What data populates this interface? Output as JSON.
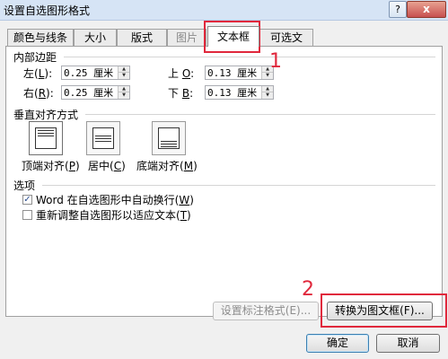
{
  "window": {
    "title": "设置自选图形格式",
    "help_label": "?",
    "close_label": "x"
  },
  "tabs": [
    {
      "label": "颜色与线条",
      "state": "normal"
    },
    {
      "label": "大小",
      "state": "normal"
    },
    {
      "label": "版式",
      "state": "normal"
    },
    {
      "label": "图片",
      "state": "disabled"
    },
    {
      "label": "文本框",
      "state": "active"
    },
    {
      "label": "可选文字",
      "state": "normal"
    }
  ],
  "internal_margin": {
    "title": "内部边距",
    "left": {
      "label": "左",
      "key": "L",
      "value": "0.25 厘米"
    },
    "right": {
      "label": "右",
      "key": "R",
      "value": "0.25 厘米"
    },
    "top": {
      "label": "上",
      "key": "O",
      "value": "0.13 厘米"
    },
    "bottom": {
      "label": "下",
      "key": "B",
      "value": "0.13 厘米"
    }
  },
  "vertical_align": {
    "title": "垂直对齐方式",
    "options": [
      {
        "label": "顶端对齐",
        "key": "P",
        "selected": true
      },
      {
        "label": "居中",
        "key": "C",
        "selected": false
      },
      {
        "label": "底端对齐",
        "key": "M",
        "selected": false
      }
    ]
  },
  "options": {
    "title": "选项",
    "word_wrap": {
      "label": "Word 在自选图形中自动换行",
      "key": "W",
      "checked": true
    },
    "resize": {
      "label": "重新调整自选图形以适应文本",
      "key": "T",
      "checked": false
    }
  },
  "buttons": {
    "callout_format": "设置标注格式(E)...",
    "convert_frame": "转换为图文框(F)...",
    "ok": "确定",
    "cancel": "取消"
  },
  "annotations": {
    "marker_1": "1",
    "marker_2": "2",
    "highlight_color": "#e0283c"
  }
}
